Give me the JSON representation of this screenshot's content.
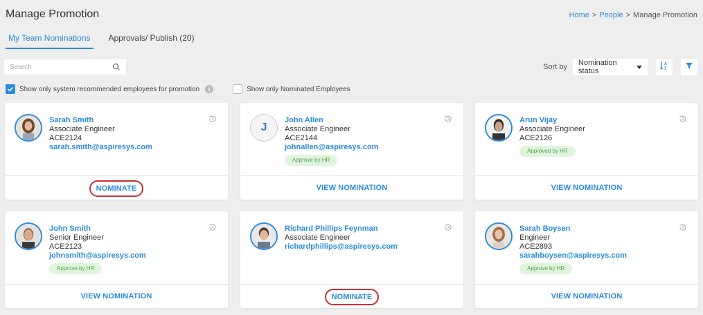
{
  "page": {
    "title": "Manage Promotion",
    "breadcrumb": [
      "Home",
      "People",
      "Manage Promotion"
    ],
    "breadcrumb_sep": ">"
  },
  "tabs": [
    "My Team Nominations",
    "Approvals/ Publish (20)"
  ],
  "search": {
    "placeholder": "Search"
  },
  "sort": {
    "label": "Sort by",
    "value": "Nomination status"
  },
  "filters": {
    "recommended": {
      "label": "Show only system recommended employees for promotion",
      "checked": true
    },
    "nominated": {
      "label": "Show only Nominated Employees",
      "checked": false
    }
  },
  "colors": {
    "accent": "#2a8ae0",
    "badge_bg": "#dff5dc",
    "badge_text": "#5a9d55",
    "highlight": "#c43131"
  },
  "employees": [
    {
      "name": "Sarah Smith",
      "role": "Associate Engineer",
      "code": "ACE2124",
      "email": "sarah.smith@aspiresys.com",
      "badge": "",
      "action": "NOMINATE",
      "avatar": "photo-woman-1"
    },
    {
      "name": "John Allen",
      "role": "Associate Engineer",
      "code": "ACE2144",
      "email": "johnallen@aspiresys.com",
      "badge": "Approve by HR",
      "action": "VIEW NOMINATION",
      "avatar": "J"
    },
    {
      "name": "Arun Vijay",
      "role": "Associate Engineer",
      "code": "ACE2126",
      "email": "",
      "badge": "Approved by HR",
      "action": "VIEW NOMINATION",
      "avatar": "photo-man-1"
    },
    {
      "name": "John Smith",
      "role": "Senior Engineer",
      "code": "ACE2123",
      "email": "johnsmith@aspiresys.com",
      "badge": "Approve by HR",
      "action": "VIEW NOMINATION",
      "avatar": "photo-man-2"
    },
    {
      "name": "Richard Phillips Feynman",
      "role": "Associate Engineer",
      "code": "",
      "email": "richardphillips@aspiresys.com",
      "badge": "",
      "action": "NOMINATE",
      "avatar": "photo-man-3"
    },
    {
      "name": "Sarah Boysen",
      "role": "Engineer",
      "code": "ACE2893",
      "email": "sarahboysen@aspiresys.com",
      "badge": "Approve by HR",
      "action": "VIEW NOMINATION",
      "avatar": "photo-woman-2"
    }
  ]
}
